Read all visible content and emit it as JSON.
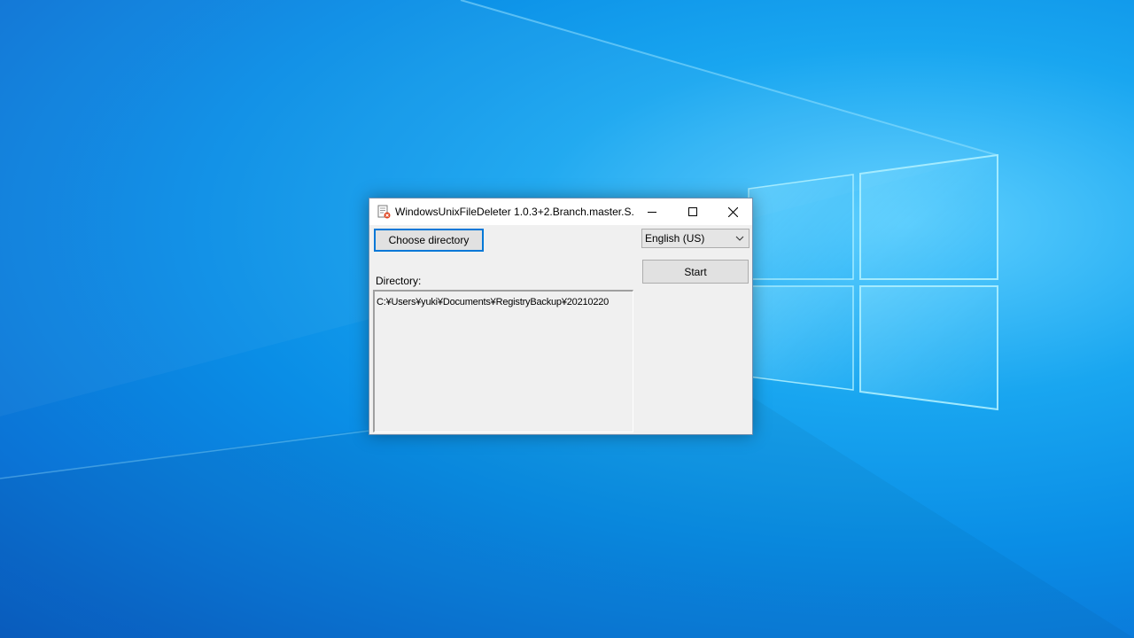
{
  "window": {
    "title": "WindowsUnixFileDeleter 1.0.3+2.Branch.master.S...",
    "icon": "app-icon",
    "controls": {
      "minimize_icon": "minimize-icon",
      "maximize_icon": "maximize-icon",
      "close_icon": "close-icon"
    }
  },
  "main": {
    "choose_directory_label": "Choose directory",
    "language_selected": "English (US)",
    "start_label": "Start",
    "directory_label": "Directory:",
    "directory_value": "C:¥Users¥yuki¥Documents¥RegistryBackup¥20210220"
  },
  "colors": {
    "accent": "#0078d7",
    "window_bg": "#f0f0f0",
    "desktop_bg": "#0a8ee6"
  }
}
